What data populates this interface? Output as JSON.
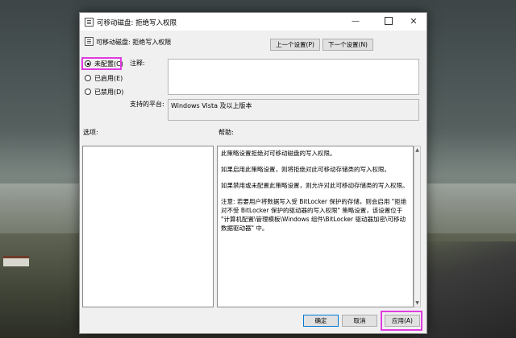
{
  "window": {
    "title": "可移动磁盘: 拒绝写入权限",
    "subtitle": "可移动磁盘: 拒绝写入权限"
  },
  "nav": {
    "prev_label": "上一个设置(P)",
    "next_label": "下一个设置(N)"
  },
  "state": {
    "options": [
      {
        "label": "未配置(C)",
        "selected": true
      },
      {
        "label": "已启用(E)",
        "selected": false
      },
      {
        "label": "已禁用(D)",
        "selected": false
      }
    ]
  },
  "fields": {
    "comment_label": "注释:",
    "comment_value": "",
    "platform_label": "支持的平台:",
    "platform_value": "Windows Vista 及以上版本"
  },
  "sections": {
    "options_label": "选项:",
    "help_label": "帮助:"
  },
  "help": {
    "paragraphs": [
      "此策略设置拒绝对可移动磁盘的写入权限。",
      "如果启用此策略设置，则将拒绝对此可移动存储类的写入权限。",
      "如果禁用或未配置此策略设置，则允许对此可移动存储类的写入权限。",
      "注意: 若要用户将数据写入受 BitLocker 保护的存储，则会启用 \"拒绝对不受 BitLocker 保护的驱动器的写入权限\" 策略设置，该设置位于 \"计算机配置\\管理模板\\Windows 组件\\BitLocker 驱动器加密\\可移动数据驱动器\" 中。"
    ]
  },
  "footer": {
    "ok_label": "确定",
    "cancel_label": "取消",
    "apply_label": "应用(A)"
  },
  "colors": {
    "highlight": "#e03ce0",
    "default_button_border": "#0078d7"
  },
  "icons": {
    "title": "policy-document-icon",
    "subtitle": "policy-document-icon",
    "minimize": "minimize-icon",
    "maximize": "maximize-icon",
    "close": "close-icon"
  }
}
